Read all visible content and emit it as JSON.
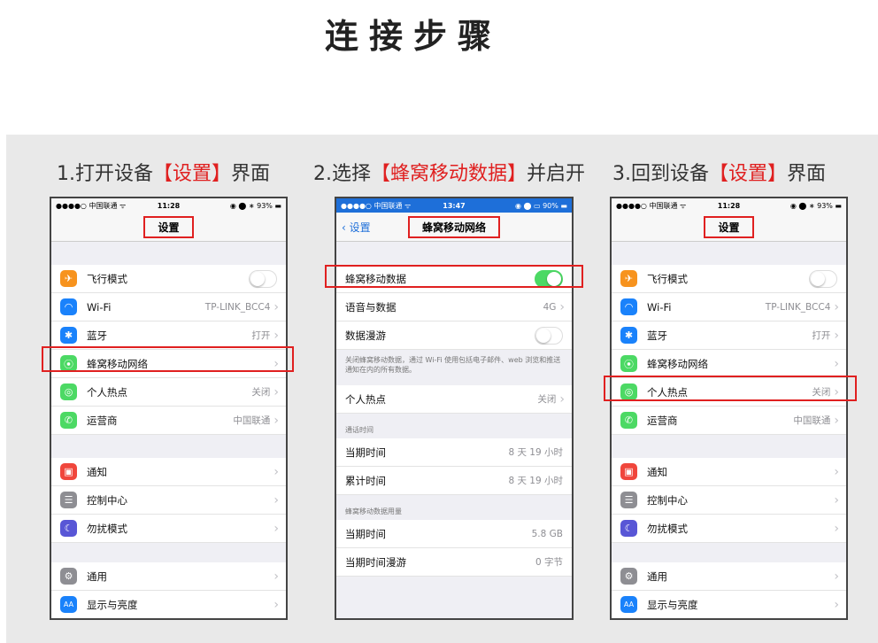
{
  "main_title": "连接步骤",
  "steps": [
    {
      "prefix": "1.打开设备",
      "bracket_open": "【",
      "highlight": "设置",
      "bracket_close": "】",
      "suffix": "界面"
    },
    {
      "prefix": "2.选择",
      "bracket_open": "【",
      "highlight": "蜂窝移动数据",
      "bracket_close": "】",
      "suffix": "并启开"
    },
    {
      "prefix": "3.回到设备",
      "bracket_open": "【",
      "highlight": "设置",
      "bracket_close": "】",
      "suffix": "界面"
    }
  ],
  "phone1": {
    "status": {
      "carrier": "●●●●○ 中国联通 ᯤ",
      "time": "11:28",
      "right": "◉ ⬤ ∗ 93% ▬"
    },
    "nav_title": "设置",
    "group1": [
      {
        "label": "飞行模式",
        "icon": "airplane-icon",
        "color": "#f7931e",
        "glyph": "✈",
        "toggle": "off"
      },
      {
        "label": "Wi-Fi",
        "icon": "wifi-icon",
        "color": "#1a82fb",
        "glyph": "◠",
        "value": "TP-LINK_BCC4"
      },
      {
        "label": "蓝牙",
        "icon": "bluetooth-icon",
        "color": "#1a82fb",
        "glyph": "✱",
        "value": "打开"
      },
      {
        "label": "蜂窝移动网络",
        "icon": "cellular-icon",
        "color": "#4cd964",
        "glyph": "⦿",
        "value": ""
      },
      {
        "label": "个人热点",
        "icon": "hotspot-icon",
        "color": "#4cd964",
        "glyph": "◎",
        "value": "关闭"
      },
      {
        "label": "运营商",
        "icon": "phone-icon",
        "color": "#4cd964",
        "glyph": "✆",
        "value": "中国联通"
      }
    ],
    "group2": [
      {
        "label": "通知",
        "icon": "notification-icon",
        "color": "#f0463c",
        "glyph": "▣"
      },
      {
        "label": "控制中心",
        "icon": "control-center-icon",
        "color": "#8e8e93",
        "glyph": "☰"
      },
      {
        "label": "勿扰模式",
        "icon": "moon-icon",
        "color": "#5856d6",
        "glyph": "☾"
      }
    ],
    "group3": [
      {
        "label": "通用",
        "icon": "gear-icon",
        "color": "#8e8e93",
        "glyph": "⚙"
      },
      {
        "label": "显示与亮度",
        "icon": "display-icon",
        "color": "#1a82fb",
        "glyph": "AA"
      }
    ]
  },
  "phone2": {
    "status": {
      "carrier": "●●●●○ 中国联通 ᯤ",
      "time": "13:47",
      "right": "◉ ⬤ ▭ 90% ▬"
    },
    "back_label": "设置",
    "nav_title": "蜂窝移动网络",
    "rows1": [
      {
        "label": "蜂窝移动数据",
        "toggle": "on"
      },
      {
        "label": "语音与数据",
        "value": "4G"
      },
      {
        "label": "数据漫游",
        "toggle": "off"
      }
    ],
    "description": "关闭蜂窝移动数据，通过 Wi-Fi 使用包括电子邮件、web 浏览和推送通知在内的所有数据。",
    "hotspot": {
      "label": "个人热点",
      "value": "关闭"
    },
    "section_call": "通话时间",
    "call_rows": [
      {
        "label": "当期时间",
        "value": "8 天 19 小时"
      },
      {
        "label": "累计时间",
        "value": "8 天 19 小时"
      }
    ],
    "section_usage": "蜂窝移动数据用量",
    "usage_rows": [
      {
        "label": "当期时间",
        "value": "5.8 GB"
      },
      {
        "label": "当期时间漫游",
        "value": "0 字节"
      }
    ]
  },
  "chevron": "›"
}
